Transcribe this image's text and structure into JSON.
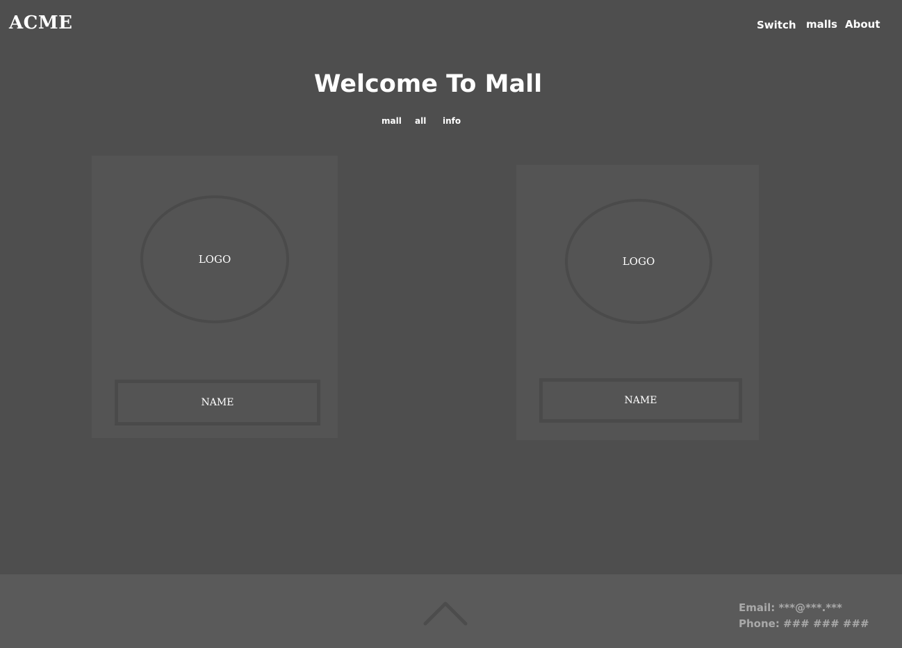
{
  "header": {
    "brand": "ACME",
    "nav": [
      "Switch",
      "malls",
      "About"
    ]
  },
  "hero": {
    "title": "Welcome To Mall",
    "subnav": [
      "mall",
      "all",
      "info"
    ]
  },
  "cards": [
    {
      "logo_label": "LOGO",
      "name_label": "NAME"
    },
    {
      "logo_label": "LOGO",
      "name_label": "NAME"
    }
  ],
  "footer": {
    "scroll_top_icon": "chevron-up-icon",
    "email": "Email: ***@***.***",
    "phone": "Phone: ### ### ###"
  },
  "colors": {
    "page_background": "#4e4e4e",
    "card_background": "#545454",
    "footer_background": "#5a5a5a",
    "footer_text": "#a9a9a9"
  }
}
